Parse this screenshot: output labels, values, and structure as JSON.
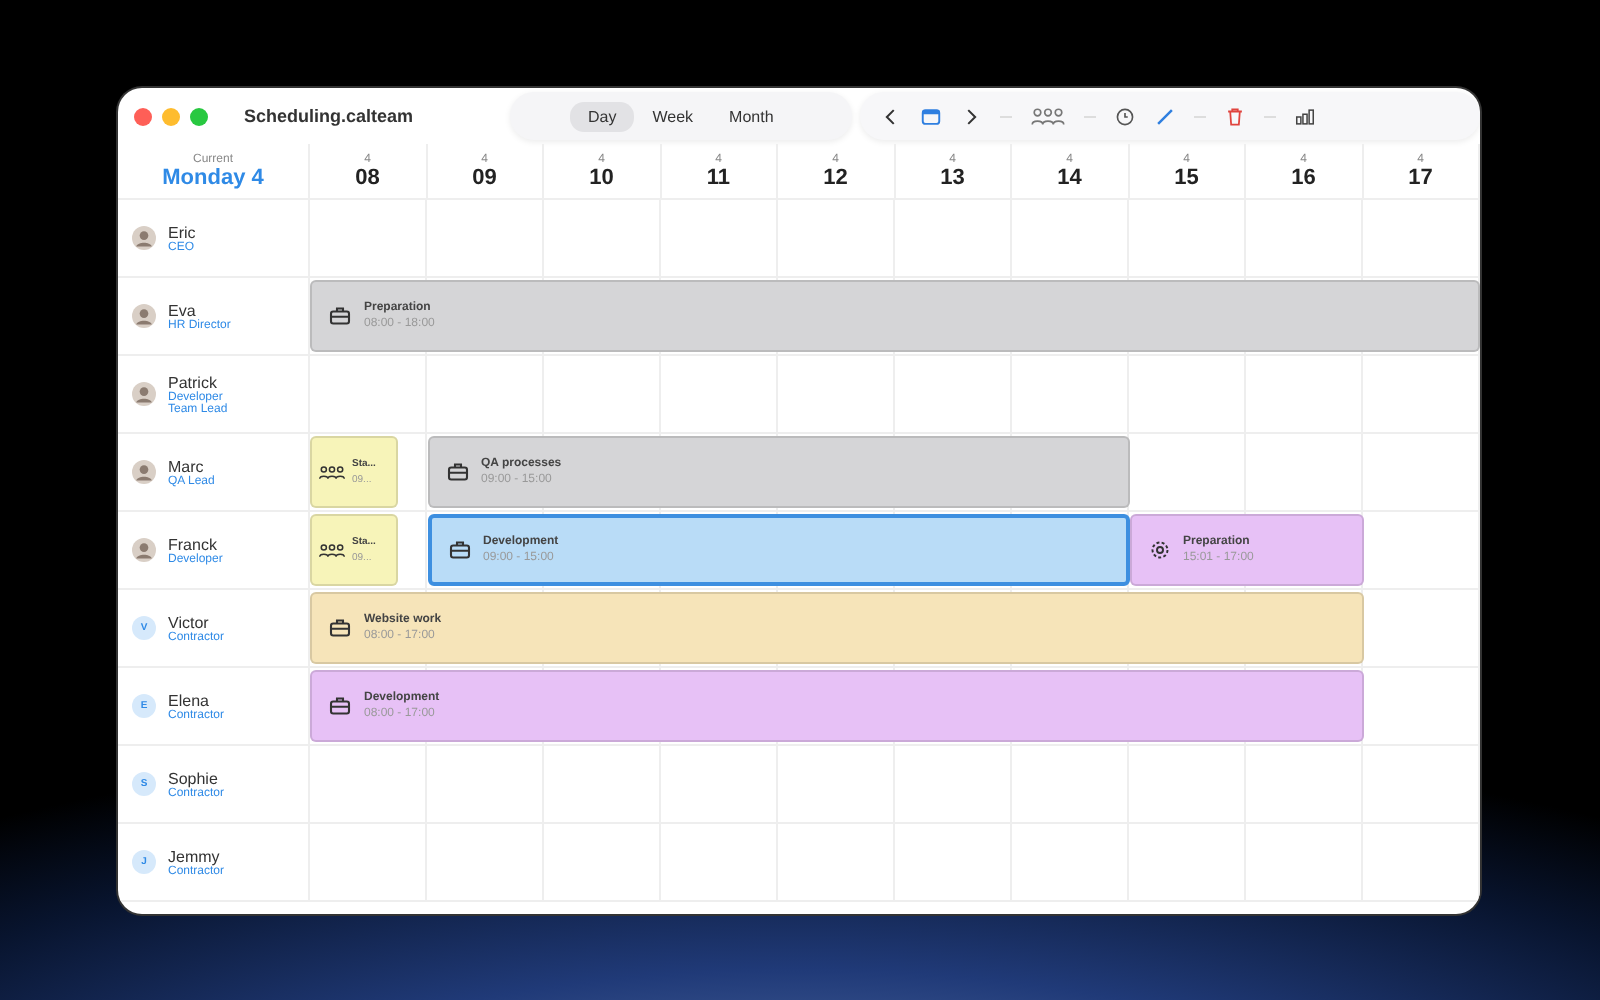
{
  "window": {
    "title": "Scheduling.calteam"
  },
  "views": [
    {
      "label": "Day",
      "selected": true
    },
    {
      "label": "Week",
      "selected": false
    },
    {
      "label": "Month",
      "selected": false
    }
  ],
  "header": {
    "caption": "Current",
    "date": "Monday 4"
  },
  "hours": [
    {
      "day": "4",
      "hour": "08"
    },
    {
      "day": "4",
      "hour": "09"
    },
    {
      "day": "4",
      "hour": "10"
    },
    {
      "day": "4",
      "hour": "11"
    },
    {
      "day": "4",
      "hour": "12"
    },
    {
      "day": "4",
      "hour": "13"
    },
    {
      "day": "4",
      "hour": "14"
    },
    {
      "day": "4",
      "hour": "15"
    },
    {
      "day": "4",
      "hour": "16"
    },
    {
      "day": "4",
      "hour": "17"
    }
  ],
  "people": [
    {
      "name": "Eric",
      "roles": [
        "CEO"
      ],
      "avatar": {
        "kind": "photo"
      }
    },
    {
      "name": "Eva",
      "roles": [
        "HR Director"
      ],
      "avatar": {
        "kind": "photo"
      },
      "events": [
        {
          "title": "Preparation",
          "time": "08:00 - 18:00",
          "kind": "task",
          "color": "#d5d5d7",
          "selected": false
        }
      ]
    },
    {
      "name": "Patrick",
      "roles": [
        "Developer",
        "Team Lead"
      ],
      "avatar": {
        "kind": "photo"
      }
    },
    {
      "name": "Marc",
      "roles": [
        "QA Lead"
      ],
      "avatar": {
        "kind": "photo"
      },
      "events": [
        {
          "title": "Sta...",
          "time": "09...",
          "kind": "meeting",
          "color": "#f7f4b9",
          "selected": false
        },
        {
          "title": "QA processes",
          "time": "09:00 - 15:00",
          "kind": "task",
          "color": "#d5d5d7",
          "selected": false
        }
      ]
    },
    {
      "name": "Franck",
      "roles": [
        "Developer"
      ],
      "avatar": {
        "kind": "photo"
      },
      "events": [
        {
          "title": "Sta...",
          "time": "09...",
          "kind": "meeting",
          "color": "#f7f4b9",
          "selected": false
        },
        {
          "title": "Development",
          "time": "09:00 - 15:00",
          "kind": "task",
          "color": "#b9dcf7",
          "selected": true
        },
        {
          "title": "Preparation",
          "time": "15:01 - 17:00",
          "kind": "setup",
          "color": "#e7c1f6",
          "selected": false
        }
      ]
    },
    {
      "name": "Victor",
      "roles": [
        "Contractor"
      ],
      "avatar": {
        "kind": "initial",
        "initial": "V"
      },
      "events": [
        {
          "title": "Website work",
          "time": "08:00 - 17:00",
          "kind": "task",
          "color": "#f6e4b9",
          "selected": false
        }
      ]
    },
    {
      "name": "Elena",
      "roles": [
        "Contractor"
      ],
      "avatar": {
        "kind": "initial",
        "initial": "E"
      },
      "events": [
        {
          "title": "Development",
          "time": "08:00 - 17:00",
          "kind": "task",
          "color": "#e7c1f6",
          "selected": false
        }
      ]
    },
    {
      "name": "Sophie",
      "roles": [
        "Contractor"
      ],
      "avatar": {
        "kind": "initial",
        "initial": "S"
      }
    },
    {
      "name": "Jemmy",
      "roles": [
        "Contractor"
      ],
      "avatar": {
        "kind": "initial",
        "initial": "J"
      }
    }
  ]
}
